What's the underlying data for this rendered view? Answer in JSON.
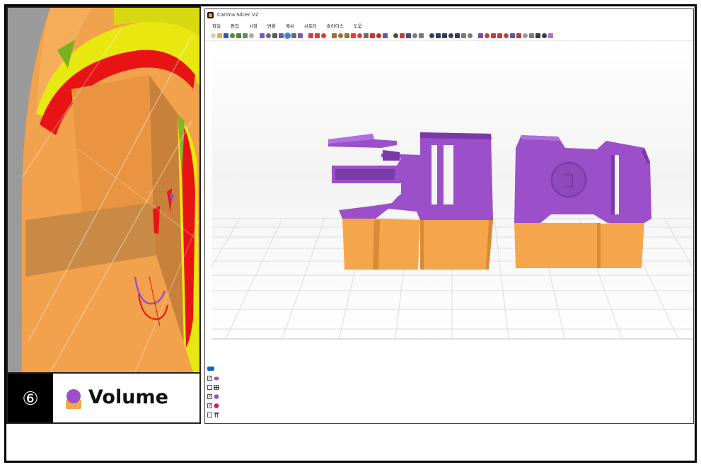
{
  "caption": {
    "number": "⑥",
    "label": "Volume",
    "icon": "volume-layer-icon"
  },
  "app": {
    "title": "Carima Slicer V2",
    "menu": [
      "파일",
      "편집",
      "시점",
      "변환",
      "메쉬",
      "서포터",
      "슬라이스",
      "도움"
    ]
  },
  "colors": {
    "purple": "#9b4fc8",
    "orange": "#f5a64a",
    "left_orange": "#f0a050",
    "red": "#e81010",
    "yellow": "#e8e800",
    "grid": "#d9d9d9",
    "selected_blue": "#1565c0"
  },
  "layer_panel": [
    {
      "checked": true,
      "icon": "purple-small-dot-icon"
    },
    {
      "checked": false,
      "icon": "grid-icon"
    },
    {
      "checked": true,
      "icon": "purple-circle-icon"
    },
    {
      "checked": true,
      "icon": "red-circle-icon"
    },
    {
      "checked": false,
      "icon": "support-tower-icon"
    }
  ]
}
